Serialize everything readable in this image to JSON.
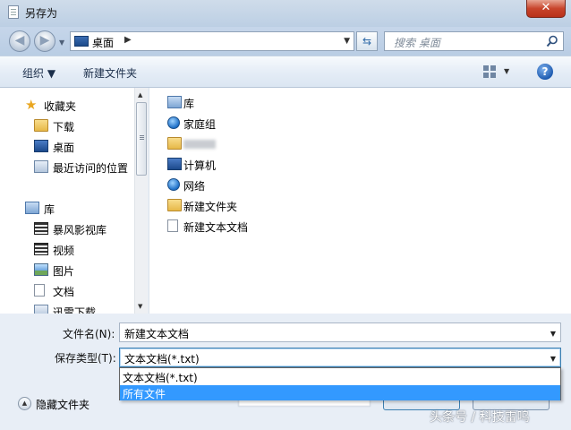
{
  "window": {
    "title": "另存为",
    "close_label": "✕"
  },
  "address": {
    "location": "桌面",
    "search_placeholder": "搜索 桌面"
  },
  "toolbar": {
    "organize": "组织 ▼",
    "new_folder": "新建文件夹",
    "help": "?"
  },
  "nav": {
    "favorites": "收藏夹",
    "downloads": "下载",
    "desktop": "桌面",
    "recent": "最近访问的位置",
    "libraries": "库",
    "storm": "暴风影视库",
    "videos": "视频",
    "pictures": "图片",
    "documents": "文档",
    "xunlei": "迅雷下载"
  },
  "files": {
    "items": [
      {
        "label": "库",
        "icon": "library-icon"
      },
      {
        "label": "家庭组",
        "icon": "homegroup-icon"
      },
      {
        "label": "",
        "icon": "user-folder-icon"
      },
      {
        "label": "计算机",
        "icon": "computer-icon"
      },
      {
        "label": "网络",
        "icon": "network-icon"
      },
      {
        "label": "新建文件夹",
        "icon": "folder-icon"
      },
      {
        "label": "新建文本文档",
        "icon": "text-document-icon"
      }
    ]
  },
  "form": {
    "filename_label": "文件名(N):",
    "filename_value": "新建文本文档",
    "filetype_label": "保存类型(T):",
    "filetype_value": "文本文档(*.txt)",
    "hide_folders": "隐藏文件夹"
  },
  "dropdown": {
    "options": [
      "文本文档(*.txt)",
      "所有文件"
    ],
    "selected_index": 1
  },
  "watermark": "头条号 / 科技雷鸣",
  "colors": {
    "selection": "#3399ff",
    "close": "#c8452c"
  }
}
